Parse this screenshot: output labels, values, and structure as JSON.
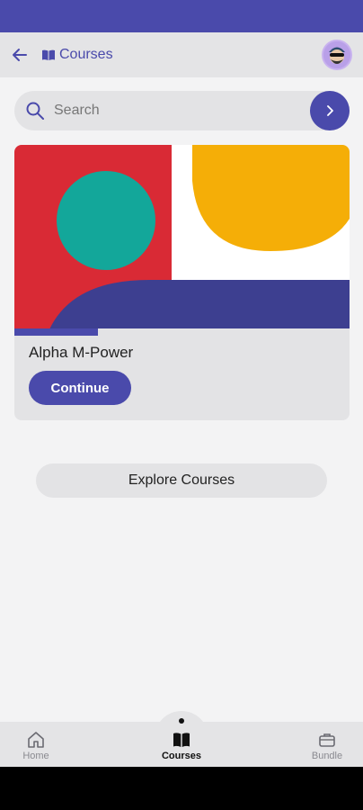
{
  "header": {
    "title": "Courses",
    "back_icon": "arrow-left-icon",
    "book_icon": "open-book-icon",
    "avatar_icon": "user-avatar-icon"
  },
  "search": {
    "placeholder": "Search",
    "value": "",
    "icon": "search-icon",
    "go_icon": "chevron-right-icon"
  },
  "courses": [
    {
      "title": "Alpha M-Power",
      "progress": 0.25,
      "button_label": "Continue"
    }
  ],
  "explore_label": "Explore Courses",
  "bottom_nav": {
    "items": [
      {
        "label": "Home",
        "icon": "home-icon",
        "active": false
      },
      {
        "label": "Courses",
        "icon": "book-icon",
        "active": true
      },
      {
        "label": "Bundle",
        "icon": "briefcase-icon",
        "active": false
      }
    ]
  },
  "colors": {
    "primary": "#4a4aab",
    "thumb_red": "#d92a35",
    "thumb_teal": "#13a79a",
    "thumb_yellow": "#f5ae07",
    "thumb_navy": "#3d3f90"
  }
}
